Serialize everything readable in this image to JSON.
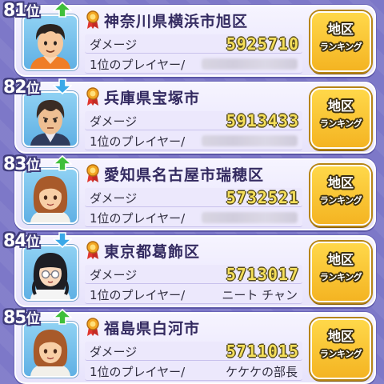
{
  "rank_suffix": "位",
  "damage_label": "ダメージ",
  "top_player_label": "1位のプレイヤー/",
  "button_line1": "地区",
  "button_line2": "ランキング",
  "colors": {
    "up_arrow": "#3fbf3a",
    "down_arrow": "#3aa8e8",
    "score": "#f5df5a",
    "button": "#f4b422"
  },
  "entries": [
    {
      "rank": "81",
      "trend": "up-arrow-icon",
      "region": "神奈川県横浜市旭区",
      "damage": "5925710",
      "player": "",
      "player_obscured": true,
      "avatar": "boy-avatar"
    },
    {
      "rank": "82",
      "trend": "down-arrow-icon",
      "region": "兵庫県宝塚市",
      "damage": "5913433",
      "player": "",
      "player_obscured": true,
      "avatar": "man-avatar"
    },
    {
      "rank": "83",
      "trend": "up-arrow-icon",
      "region": "愛知県名古屋市瑞穂区",
      "damage": "5732521",
      "player": "",
      "player_obscured": true,
      "avatar": "girl-avatar"
    },
    {
      "rank": "84",
      "trend": "down-arrow-icon",
      "region": "東京都葛飾区",
      "damage": "5713017",
      "player": "ニート チャン",
      "player_obscured": false,
      "avatar": "glasses-girl-avatar"
    },
    {
      "rank": "85",
      "trend": "up-arrow-icon",
      "region": "福島県白河市",
      "damage": "5711015",
      "player": "ケケケの部長",
      "player_obscured": false,
      "avatar": "girl-avatar"
    }
  ]
}
